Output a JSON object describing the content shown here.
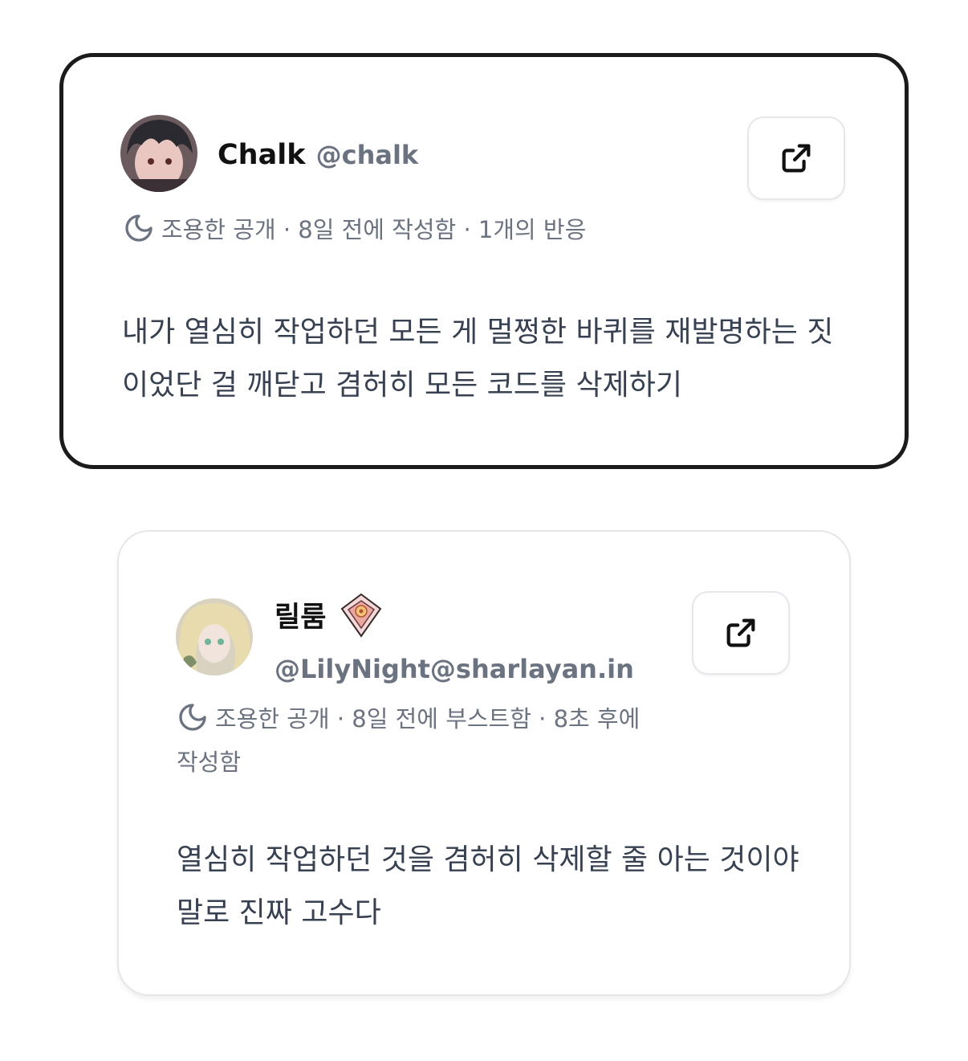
{
  "posts": [
    {
      "display_name": "Chalk",
      "handle": "@chalk",
      "meta": "조용한 공개 · 8일 전에 작성함 · 1개의 반응",
      "body": "내가 열심히 작업하던 모든 게 멀쩡한 바퀴를 재발명하는 짓이었단 걸 깨닫고 겸허히 모든 코드를 삭제하기",
      "visibility_icon": "moon-icon",
      "action_icon": "external-link-icon"
    },
    {
      "display_name": "릴룸",
      "handle": "@LilyNight@sharlayan.in",
      "meta": "조용한 공개 · 8일 전에 부스트함 · 8초 후에 작성함",
      "body": "열심히 작업하던 것을 겸허히 삭제할 줄 아는 것이야말로 진짜 고수다",
      "visibility_icon": "moon-icon",
      "badge_icon": "crystal-emblem-icon",
      "action_icon": "external-link-icon"
    }
  ]
}
